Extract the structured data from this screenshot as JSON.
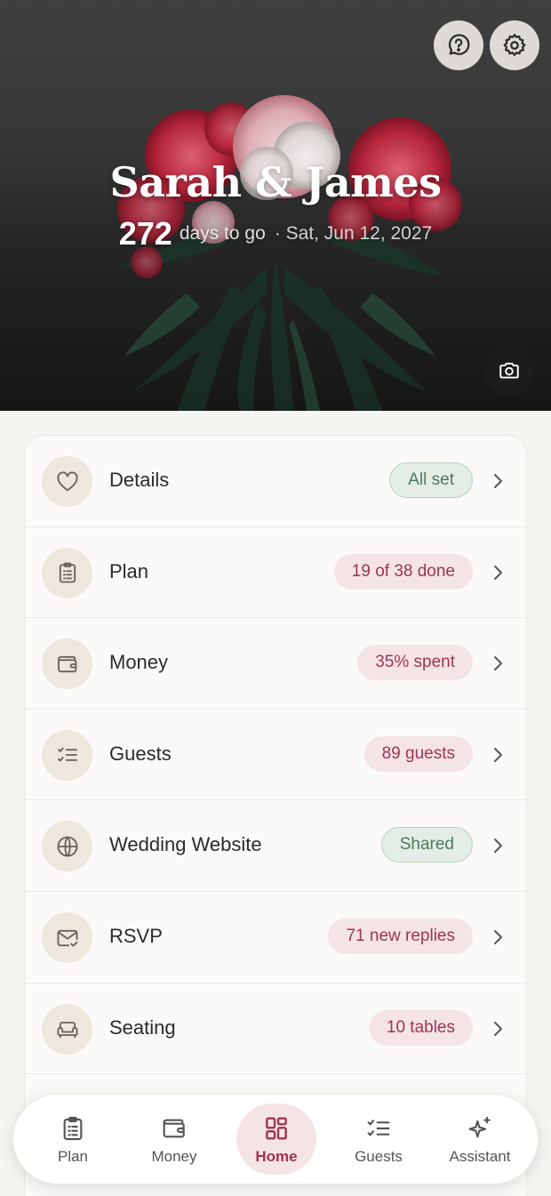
{
  "hero": {
    "couple_names": "Sarah & James",
    "days_number": "272",
    "days_text": "days to go",
    "date_text": "· Sat, Jun 12, 2027"
  },
  "sections": [
    {
      "label": "Details",
      "badge": "All set",
      "badge_style": "green",
      "icon": "heart-icon"
    },
    {
      "label": "Plan",
      "badge": "19 of 38 done",
      "badge_style": "pink",
      "icon": "clipboard-icon"
    },
    {
      "label": "Money",
      "badge": "35% spent",
      "badge_style": "pink",
      "icon": "wallet-icon"
    },
    {
      "label": "Guests",
      "badge": "89 guests",
      "badge_style": "pink",
      "icon": "checklist-icon"
    },
    {
      "label": "Wedding Website",
      "badge": "Shared",
      "badge_style": "green",
      "icon": "globe-icon"
    },
    {
      "label": "RSVP",
      "badge": "71 new replies",
      "badge_style": "pink",
      "icon": "mail-check-icon"
    },
    {
      "label": "Seating",
      "badge": "10 tables",
      "badge_style": "pink",
      "icon": "sofa-icon"
    }
  ],
  "tabs": [
    {
      "label": "Plan",
      "icon": "clipboard-icon",
      "active": false
    },
    {
      "label": "Money",
      "icon": "wallet-icon",
      "active": false
    },
    {
      "label": "Home",
      "icon": "grid-icon",
      "active": true
    },
    {
      "label": "Guests",
      "icon": "checklist-icon",
      "active": false
    },
    {
      "label": "Assistant",
      "icon": "sparkles-icon",
      "active": false
    }
  ],
  "colors": {
    "accent": "#9e3550",
    "accent_bg": "#f5e4e6",
    "success": "#4f7a5c",
    "success_bg": "#e4ede6",
    "icon_circle": "#eee7dd"
  }
}
